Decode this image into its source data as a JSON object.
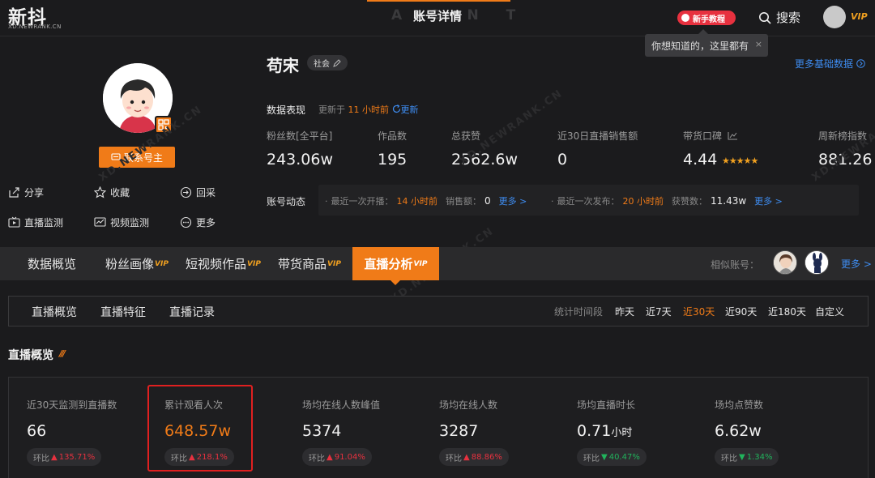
{
  "brand": {
    "logo": "新抖",
    "domain": "XD.NEWRANK.CN"
  },
  "header": {
    "title": "账号详情",
    "ghost": "A C   N T",
    "tutorial": "新手教程",
    "search": "搜索",
    "vip": "VIP",
    "tooltip": "你想知道的，这里都有",
    "tooltip_close": "×"
  },
  "profile": {
    "contact": "联系号主",
    "actions": {
      "share": "分享",
      "favorite": "收藏",
      "trace": "回采",
      "live_monitor": "直播监测",
      "video_monitor": "视频监测",
      "more": "更多"
    },
    "name": "苟宋",
    "category": "社会",
    "more_basic": "更多基础数据",
    "perf_label": "数据表现",
    "updated_prefix": "更新于",
    "updated_time": "11 小时前",
    "refresh": "更新"
  },
  "stats": [
    {
      "label": "粉丝数[全平台]",
      "value": "243.06w"
    },
    {
      "label": "作品数",
      "value": "195"
    },
    {
      "label": "总获赞",
      "value": "2562.6w"
    },
    {
      "label": "近30日直播销售额",
      "value": "0"
    },
    {
      "label": "带货口碑",
      "value": "4.44",
      "stars": "★★★★★"
    },
    {
      "label": "周新榜指数",
      "value": "881.26"
    }
  ],
  "dynamics": {
    "label": "账号动态",
    "live_prefix": "最近一次开播：",
    "live_time": "14 小时前",
    "sales_label": "销售额：",
    "sales_value": "0",
    "more1": "更多 >",
    "post_prefix": "最近一次发布：",
    "post_time": "20 小时前",
    "likes_label": "获赞数：",
    "likes_value": "11.43w",
    "more2": "更多 >"
  },
  "tabs": [
    {
      "label": "数据概览",
      "vip": ""
    },
    {
      "label": "粉丝画像",
      "vip": "VIP"
    },
    {
      "label": "短视频作品",
      "vip": "VIP"
    },
    {
      "label": "带货商品",
      "vip": "VIP"
    },
    {
      "label": "直播分析",
      "vip": "VIP"
    }
  ],
  "similar": {
    "label": "相似账号：",
    "more": "更多 >"
  },
  "subnav": {
    "items": [
      "直播概览",
      "直播特征",
      "直播记录"
    ],
    "period_label": "统计时间段",
    "periods": [
      "昨天",
      "近7天",
      "近30天",
      "近90天",
      "近180天",
      "自定义"
    ],
    "active_period": "近30天"
  },
  "section": {
    "title": "直播概览",
    "deco": "///"
  },
  "metrics": [
    {
      "label": "近30天监测到直播数",
      "value": "66",
      "unit": "",
      "change_label": "环比",
      "change": "135.71%",
      "dir": "up"
    },
    {
      "label": "累计观看人次",
      "value": "648.57w",
      "unit": "",
      "change_label": "环比",
      "change": "218.1%",
      "dir": "up"
    },
    {
      "label": "场均在线人数峰值",
      "value": "5374",
      "unit": "",
      "change_label": "环比",
      "change": "91.04%",
      "dir": "up"
    },
    {
      "label": "场均在线人数",
      "value": "3287",
      "unit": "",
      "change_label": "环比",
      "change": "88.86%",
      "dir": "up"
    },
    {
      "label": "场均直播时长",
      "value": "0.71",
      "unit": "小时",
      "change_label": "环比",
      "change": "40.47%",
      "dir": "down"
    },
    {
      "label": "场均点赞数",
      "value": "6.62w",
      "unit": "",
      "change_label": "环比",
      "change": "1.34%",
      "dir": "down"
    }
  ],
  "arrows": {
    "up": "▲",
    "down": "▼"
  },
  "watermark": "XD.NEWRANK.CN",
  "colors": {
    "accent": "#f07b18",
    "link": "#3e8cf0",
    "up": "#e7313f",
    "down": "#21b35c",
    "highlight": "#e02020"
  }
}
